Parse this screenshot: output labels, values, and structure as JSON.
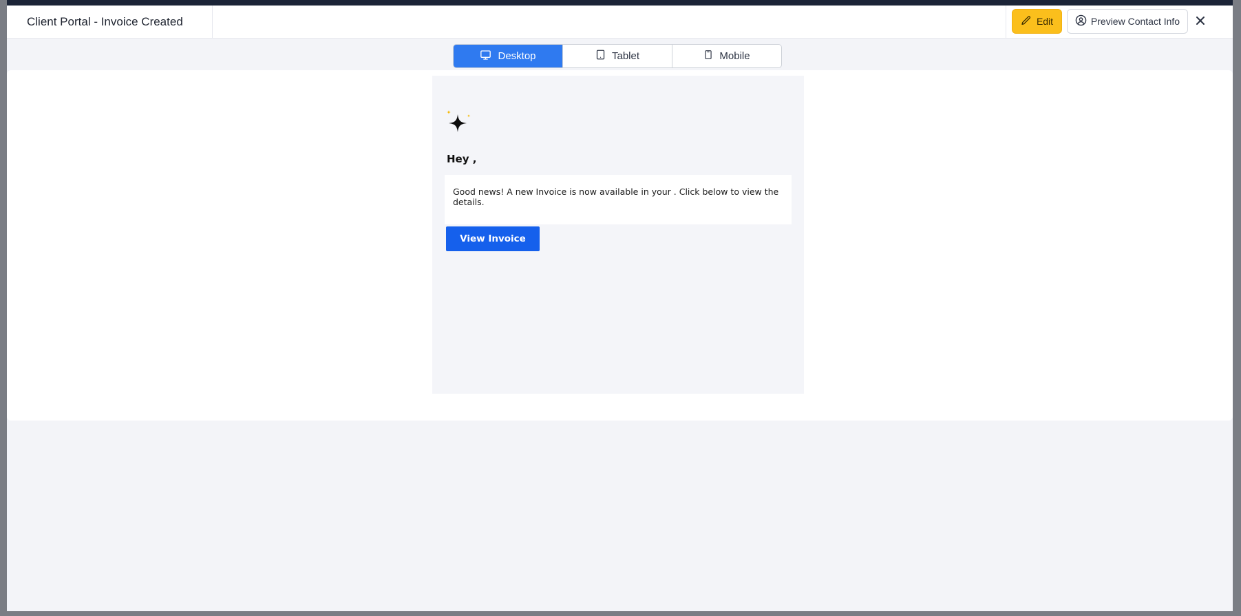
{
  "modal": {
    "title": "Client Portal - Invoice Created",
    "edit_label": "Edit",
    "preview_contact_label": "Preview Contact Info"
  },
  "device_tabs": [
    {
      "label": "Desktop",
      "icon": "monitor-icon",
      "active": true
    },
    {
      "label": "Tablet",
      "icon": "tablet-icon",
      "active": false
    },
    {
      "label": "Mobile",
      "icon": "mobile-icon",
      "active": false
    }
  ],
  "email": {
    "greeting": "Hey ,",
    "message": "Good news! A new Invoice is now available in your . Click below to view the details.",
    "button_label": "View Invoice"
  },
  "colors": {
    "edit_button": "#fbbf1c",
    "active_tab": "#2f7af0",
    "cta_button": "#1560ec",
    "sparkle_accent": "#f5b800"
  }
}
